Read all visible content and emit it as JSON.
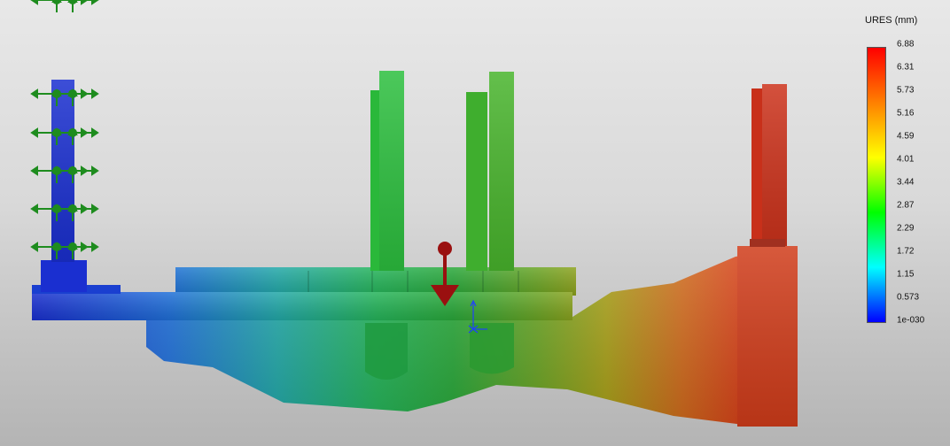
{
  "legend": {
    "title": "URES (mm)",
    "ticks": [
      "6.88",
      "6.31",
      "5.73",
      "5.16",
      "4.59",
      "4.01",
      "3.44",
      "2.87",
      "2.29",
      "1.72",
      "1.15",
      "0.573",
      "1e-030"
    ],
    "colors": [
      "#ff0000",
      "#ff8000",
      "#ffff00",
      "#00ff00",
      "#00ffff",
      "#0000ff"
    ]
  },
  "model": {
    "fixture_rows": 5,
    "load_indicator": "load-arrow",
    "coordinate_triad": "axis-triad"
  }
}
